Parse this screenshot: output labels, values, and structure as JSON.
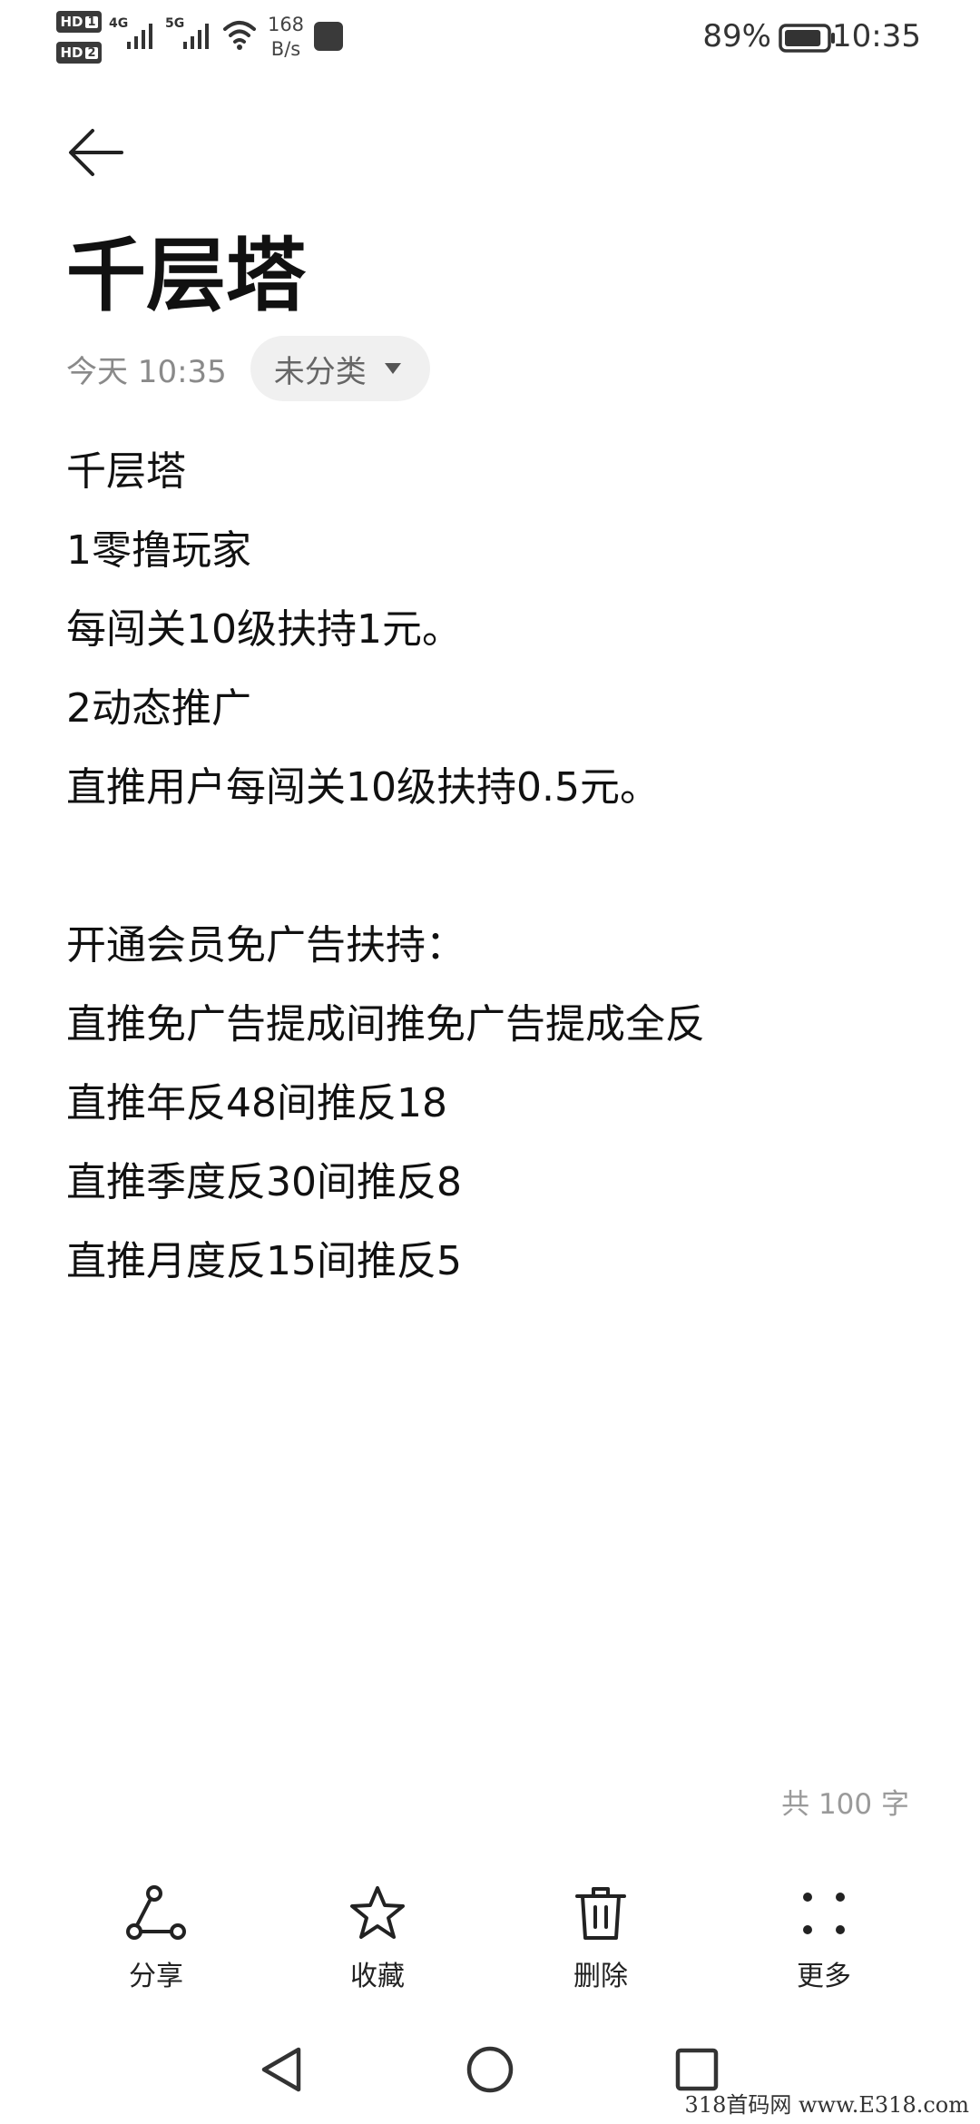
{
  "status_bar": {
    "sim1_label": "HD",
    "sim1_num": "1",
    "sim2_label": "HD",
    "sim2_num": "2",
    "net1_tech": "4G",
    "net2_tech": "5G",
    "speed_value": "168",
    "speed_unit": "B/s",
    "battery_percent": "89%",
    "battery_level": 0.89,
    "time": "10:35"
  },
  "header": {
    "title": "千层塔",
    "date": "今天 10:35",
    "category": "未分类"
  },
  "body": {
    "lines": [
      "千层塔",
      "1零撸玩家",
      "每闯关10级扶持1元。",
      "2动态推广",
      "直推用户每闯关10级扶持0.5元。",
      "",
      "开通会员免广告扶持：",
      "直推免广告提成间推免广告提成全反",
      "直推年反48间推反18",
      "直推季度反30间推反8",
      "直推月度反15间推反5"
    ]
  },
  "word_count": "共 100 字",
  "toolbar": {
    "share_label": "分享",
    "favorite_label": "收藏",
    "delete_label": "删除",
    "more_label": "更多"
  },
  "watermark": "318首码网 www.E318.com"
}
